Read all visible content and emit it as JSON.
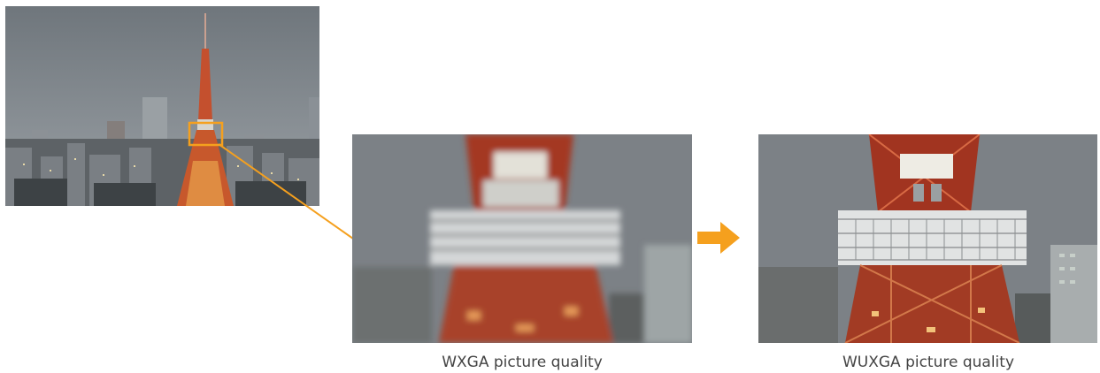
{
  "captions": {
    "wxga": "WXGA picture quality",
    "wuxga": "WUXGA picture quality"
  },
  "colors": {
    "accent": "#f5a01e",
    "sky": "#7c8288",
    "tower": "#b83a22"
  },
  "images": {
    "overview": "tokyo-tower-cityscape",
    "wxga": "tokyo-tower-observatory-blurred",
    "wuxga": "tokyo-tower-observatory-sharp"
  }
}
